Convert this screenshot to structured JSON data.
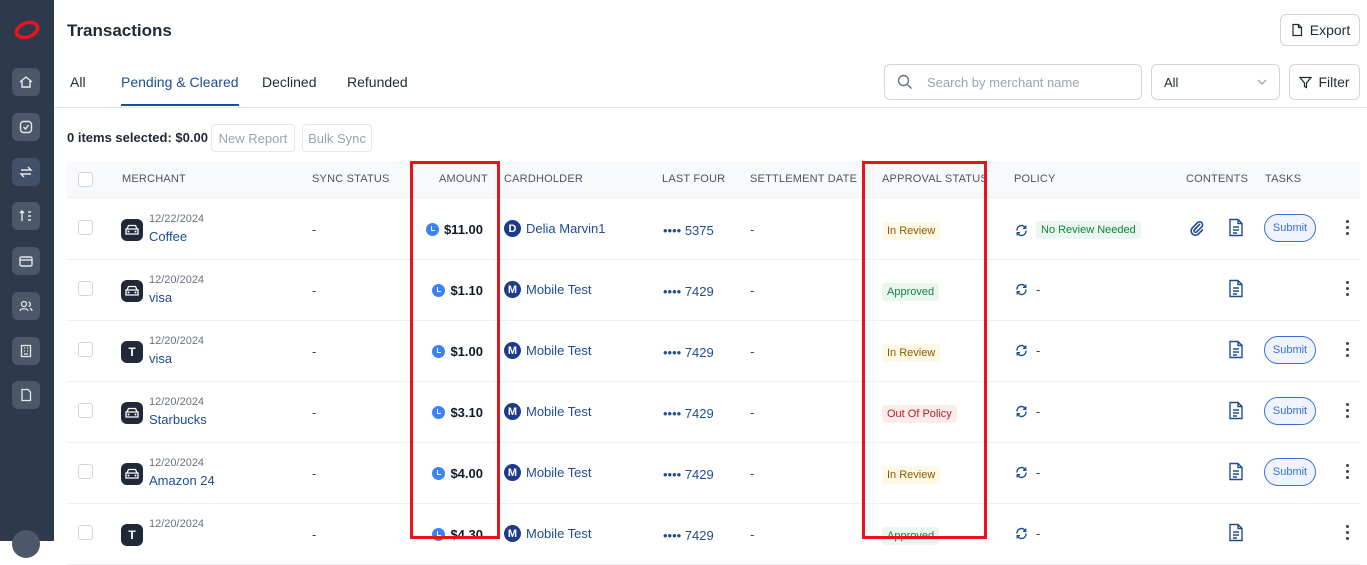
{
  "app": {
    "title": "Transactions",
    "export_label": "Export"
  },
  "tabs": [
    {
      "label": "All"
    },
    {
      "label": "Pending & Cleared"
    },
    {
      "label": "Declined"
    },
    {
      "label": "Refunded"
    }
  ],
  "search": {
    "placeholder": "Search by merchant name"
  },
  "status_filter": {
    "value": "All"
  },
  "filter_label": "Filter",
  "selection": {
    "text": "0 items selected: $0.00",
    "new_report": "New Report",
    "bulk_sync": "Bulk Sync"
  },
  "columns": [
    "MERCHANT",
    "SYNC STATUS",
    "AMOUNT",
    "CARDHOLDER",
    "LAST FOUR",
    "SETTLEMENT DATE",
    "APPROVAL STATUS",
    "POLICY",
    "CONTENTS",
    "TASKS"
  ],
  "rows": [
    {
      "logo": "car-icon",
      "date": "12/22/2024",
      "merchant": "Coffee",
      "sync": "-",
      "amount": "$11.00",
      "avatar": "D",
      "cardholder": "Delia Marvin1",
      "last4": "•••• 5375",
      "settlement": "-",
      "approval": "In Review",
      "policy": "No Review Needed",
      "submit": "Submit"
    },
    {
      "logo": "car-icon",
      "date": "12/20/2024",
      "merchant": "visa",
      "sync": "-",
      "amount": "$1.10",
      "avatar": "M",
      "cardholder": "Mobile Test",
      "last4": "•••• 7429",
      "settlement": "-",
      "approval": "Approved",
      "policy": "-",
      "submit": ""
    },
    {
      "logo": "T",
      "date": "12/20/2024",
      "merchant": "visa",
      "sync": "-",
      "amount": "$1.00",
      "avatar": "M",
      "cardholder": "Mobile Test",
      "last4": "•••• 7429",
      "settlement": "-",
      "approval": "In Review",
      "policy": "-",
      "submit": "Submit"
    },
    {
      "logo": "car-icon",
      "date": "12/20/2024",
      "merchant": "Starbucks",
      "sync": "-",
      "amount": "$3.10",
      "avatar": "M",
      "cardholder": "Mobile Test",
      "last4": "•••• 7429",
      "settlement": "-",
      "approval": "Out Of Policy",
      "policy": "-",
      "submit": "Submit"
    },
    {
      "logo": "car-icon",
      "date": "12/20/2024",
      "merchant": "Amazon 24",
      "sync": "-",
      "amount": "$4.00",
      "avatar": "M",
      "cardholder": "Mobile Test",
      "last4": "•••• 7429",
      "settlement": "-",
      "approval": "In Review",
      "policy": "-",
      "submit": "Submit"
    },
    {
      "logo": "T",
      "date": "12/20/2024",
      "merchant": "",
      "sync": "-",
      "amount": "$4.30",
      "avatar": "M",
      "cardholder": "Mobile Test",
      "last4": "•••• 7429",
      "settlement": "-",
      "approval": "Approved",
      "policy": "-",
      "submit": ""
    }
  ],
  "colors": {
    "sidebar": "#2d3a4c",
    "accent": "#1e4d91",
    "highlight": "#e8141c"
  }
}
